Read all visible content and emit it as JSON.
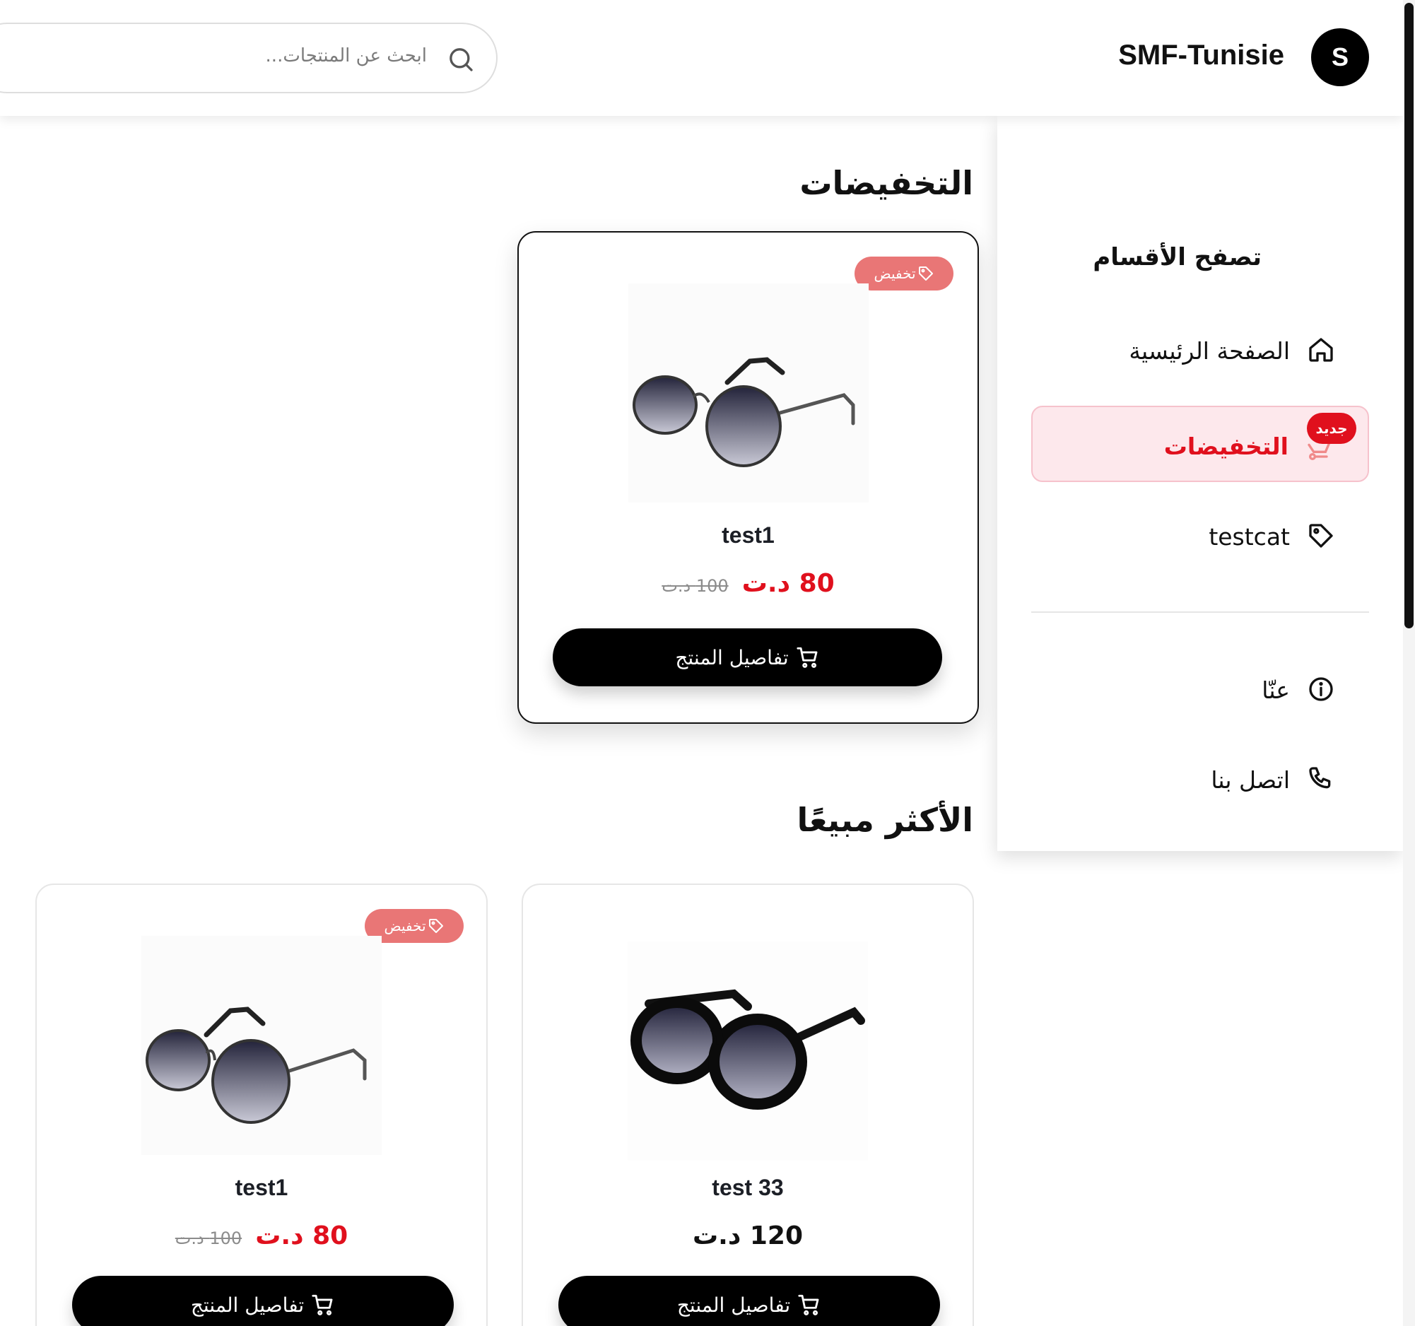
{
  "header": {
    "search_placeholder": "ابحث عن المنتجات...",
    "brand_name": "SMF-Tunisie",
    "brand_initial": "S"
  },
  "sidebar": {
    "title": "تصفح الأقسام",
    "items": [
      {
        "label": "الصفحة الرئيسية",
        "icon": "home-icon"
      },
      {
        "label": "التخفيضات",
        "icon": "sale-icon",
        "badge": "جديد",
        "active": true
      },
      {
        "label": "testcat",
        "icon": "tag-icon"
      },
      {
        "label": "عنّا",
        "icon": "info-icon"
      },
      {
        "label": "اتصل بنا",
        "icon": "phone-icon"
      }
    ]
  },
  "sections": {
    "sales_title": "التخفيضات",
    "bestsellers_title": "الأكثر مبيعًا"
  },
  "products": {
    "sale": [
      {
        "name": "test1",
        "badge": "تخفيض",
        "price": "80 د.ت",
        "old_price": "100 د.ت",
        "button": "تفاصيل المنتج",
        "image": "round-metal-sunglasses"
      }
    ],
    "bestsellers": [
      {
        "name": "test 33",
        "price": "120 د.ت",
        "button": "تفاصيل المنتج",
        "image": "black-round-sunglasses"
      },
      {
        "name": "test1",
        "badge": "تخفيض",
        "price": "80 د.ت",
        "old_price": "100 د.ت",
        "button": "تفاصيل المنتج",
        "image": "round-metal-sunglasses"
      }
    ]
  },
  "colors": {
    "accent_red": "#e0101d",
    "sale_badge": "#e97676",
    "active_bg": "#fde8ec",
    "button_bg": "#000000"
  }
}
